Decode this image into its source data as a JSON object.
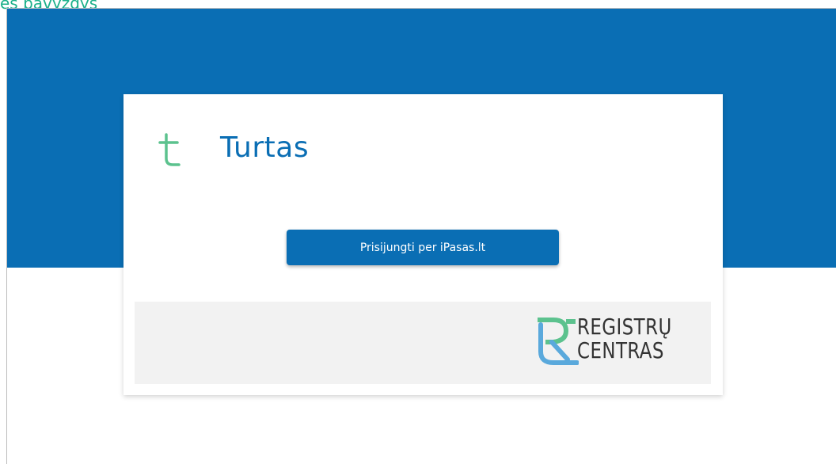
{
  "caption": "ės pavyzdys",
  "app": {
    "title": "Turtas",
    "icon": "turtas-t-icon"
  },
  "login": {
    "button_label": "Prisijungti per iPasas.lt"
  },
  "footer": {
    "logo_line1": "REGISTRŲ",
    "logo_line2": "CENTRAS",
    "logo_icon": "registru-centras-r-icon"
  },
  "colors": {
    "brand_blue": "#0a6eb4",
    "accent_green": "#5cc28e",
    "footer_gray": "#f2f2f2"
  }
}
